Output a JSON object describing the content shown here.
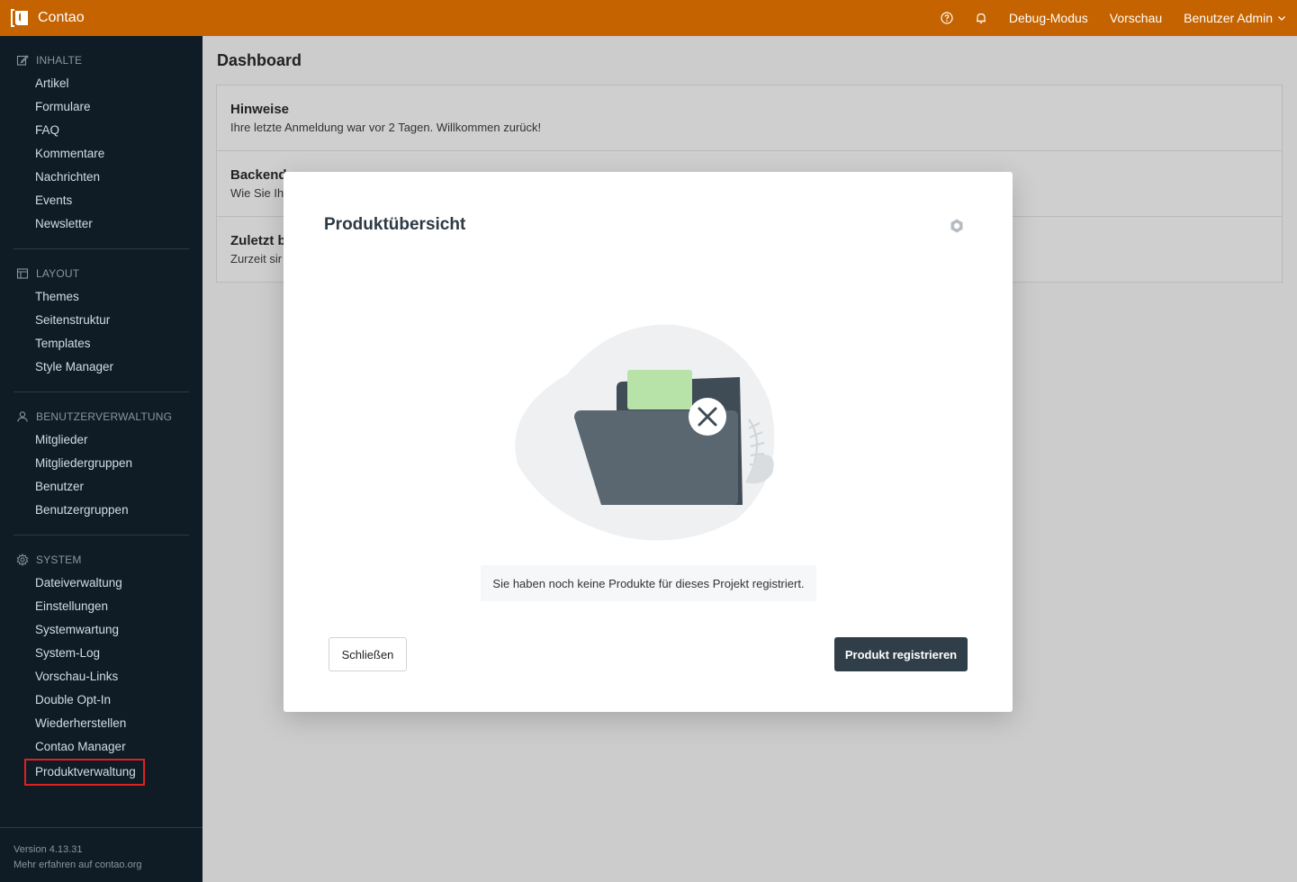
{
  "header": {
    "app_name": "Contao",
    "links": [
      "Debug-Modus",
      "Vorschau"
    ],
    "user_menu": "Benutzer Admin",
    "brand_color": "#c46300"
  },
  "sidebar": {
    "groups": [
      {
        "title": "INHALTE",
        "icon": "edit-icon",
        "items": [
          "Artikel",
          "Formulare",
          "FAQ",
          "Kommentare",
          "Nachrichten",
          "Events",
          "Newsletter"
        ]
      },
      {
        "title": "LAYOUT",
        "icon": "layout-icon",
        "items": [
          "Themes",
          "Seitenstruktur",
          "Templates",
          "Style Manager"
        ]
      },
      {
        "title": "BENUTZERVERWALTUNG",
        "icon": "user-icon",
        "items": [
          "Mitglieder",
          "Mitgliedergruppen",
          "Benutzer",
          "Benutzergruppen"
        ]
      },
      {
        "title": "SYSTEM",
        "icon": "gear-icon",
        "items": [
          "Dateiverwaltung",
          "Einstellungen",
          "Systemwartung",
          "System-Log",
          "Vorschau-Links",
          "Double Opt-In",
          "Wiederherstellen",
          "Contao Manager",
          "Produktverwaltung"
        ]
      }
    ],
    "footer": {
      "version": "Version 4.13.31",
      "more": "Mehr erfahren auf contao.org"
    }
  },
  "main": {
    "title": "Dashboard",
    "panels": [
      {
        "title": "Hinweise",
        "text": "Ihre letzte Anmeldung war vor 2 Tagen. Willkommen zurück!"
      },
      {
        "title": "Backend",
        "text": "Wie Sie Ih"
      },
      {
        "title": "Zuletzt b",
        "text": "Zurzeit sir"
      }
    ]
  },
  "modal": {
    "title": "Produktübersicht",
    "message": "Sie haben noch keine Produkte für dieses Projekt registriert.",
    "close_label": "Schließen",
    "register_label": "Produkt registrieren"
  }
}
